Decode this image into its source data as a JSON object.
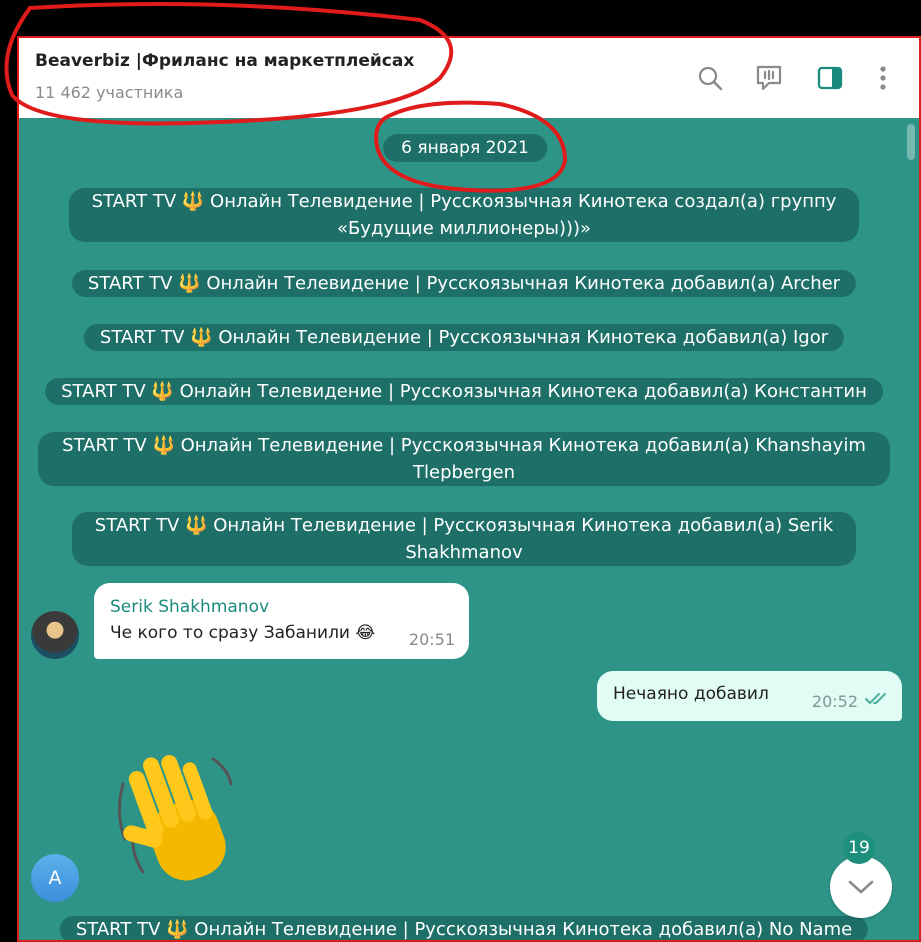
{
  "header": {
    "title": "Beaverbiz |Фриланс на маркетплейсах",
    "subtitle": "11 462 участника",
    "icons": [
      "search-icon",
      "chat-bubble-icon",
      "sidebar-panel-icon",
      "more-vertical-icon"
    ]
  },
  "date_separator": "6 января 2021",
  "service_messages": [
    {
      "prefix": "START TV",
      "emoji": "🔱",
      "lines": [
        "Онлайн Телевидение | Русскоязычная Кинотека создал(а) группу",
        "«Будущие миллионеры)))»"
      ]
    },
    {
      "prefix": "START TV",
      "emoji": "🔱",
      "lines": [
        "Онлайн Телевидение | Русскоязычная Кинотека добавил(а) Archer"
      ]
    },
    {
      "prefix": "START TV",
      "emoji": "🔱",
      "lines": [
        "Онлайн Телевидение | Русскоязычная Кинотека добавил(а) Igor"
      ]
    },
    {
      "prefix": "START TV",
      "emoji": "🔱",
      "lines": [
        "Онлайн Телевидение | Русскоязычная Кинотека добавил(а) Константин"
      ]
    },
    {
      "prefix": "START TV",
      "emoji": "🔱",
      "lines": [
        "Онлайн Телевидение | Русскоязычная Кинотека добавил(а) Khanshayim",
        "Tlepbergen"
      ]
    },
    {
      "prefix": "START TV",
      "emoji": "🔱",
      "lines": [
        "Онлайн Телевидение | Русскоязычная Кинотека добавил(а) Serik",
        "Shakhmanov"
      ]
    },
    {
      "prefix": "START TV",
      "emoji": "🔱",
      "lines": [
        "Онлайн Телевидение | Русскоязычная Кинотека добавил(а) No Name"
      ]
    }
  ],
  "messages": [
    {
      "sender": "Serik Shakhmanov",
      "text": "Че кого то сразу Забанили 😂",
      "time": "20:51",
      "direction": "incoming"
    },
    {
      "text": "Нечаяно добавил",
      "time": "20:52",
      "direction": "outgoing",
      "status": "read"
    }
  ],
  "sticker": "waving-hand-sticker",
  "avatar_letter": "A",
  "unread_count": "19",
  "colors": {
    "chat_background": "#2e9488",
    "service_pill": "#1e6f68",
    "accent": "#1a8a7d",
    "annotation": "#e01b1b"
  }
}
